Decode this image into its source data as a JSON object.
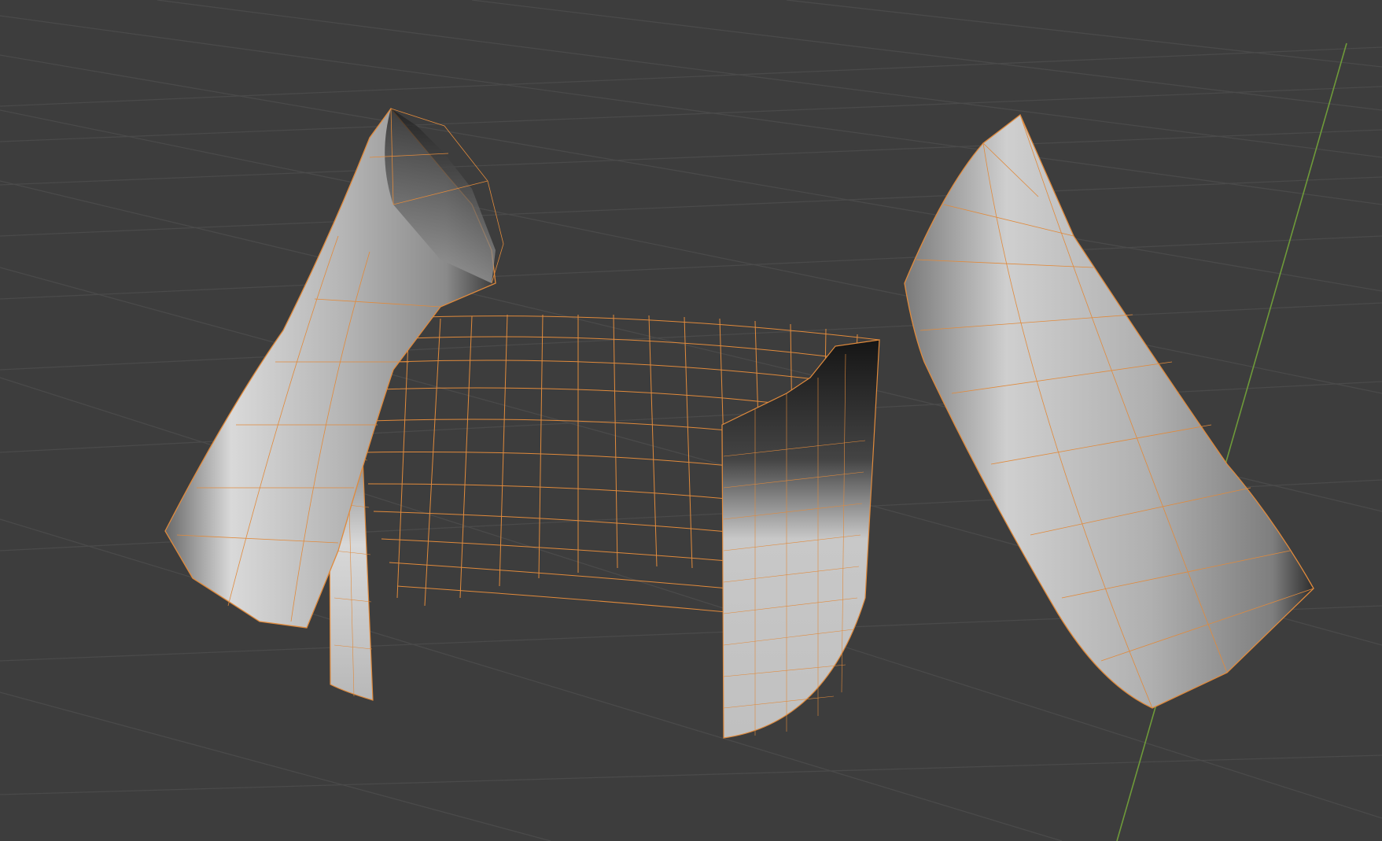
{
  "viewport": {
    "background_color": "#3d3d3d",
    "grid_color": "#4a4a4a",
    "y_axis_color": "#6e9a3a",
    "wire_color": "#e08a3c",
    "mode": "edit-mode-selected-wireframe"
  },
  "objects": [
    {
      "name": "left-cylinder-mesh",
      "state": "selected"
    },
    {
      "name": "right-cylinder-mesh",
      "state": "selected"
    },
    {
      "name": "curved-wall-mesh",
      "state": "selected"
    },
    {
      "name": "left-wall-panel",
      "state": "selected"
    },
    {
      "name": "right-wall-panel",
      "state": "selected"
    }
  ]
}
